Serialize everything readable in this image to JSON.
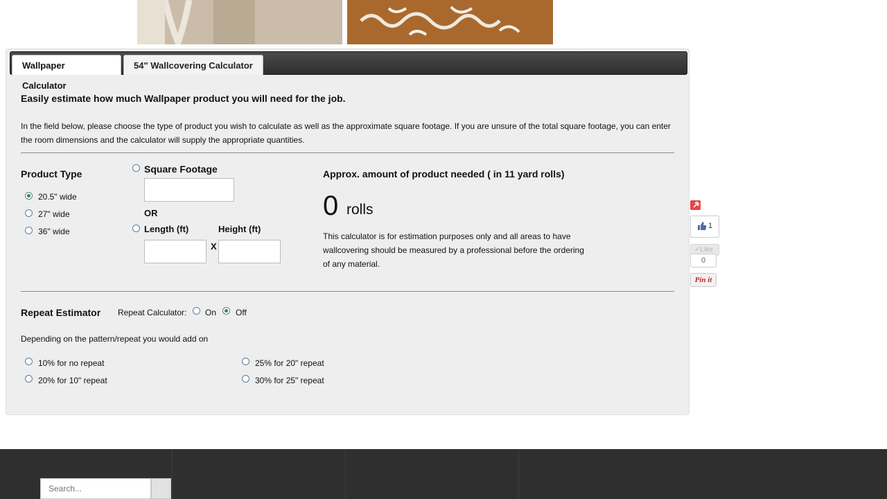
{
  "tabs": [
    {
      "label": "Wallpaper Calculator"
    },
    {
      "label": "54\" Wallcovering Calculator"
    }
  ],
  "intro": {
    "heading": "Easily estimate how much Wallpaper product you will need for the job.",
    "text": "In the field below, please choose the type of product you wish to calculate as well as the approximate square footage. If you are unsure of the total square footage, you can enter the room dimensions and the calculator will supply the appropriate quantities."
  },
  "product_type": {
    "heading": "Product Type",
    "options": [
      "20.5\" wide",
      "27\" wide",
      "36\" wide"
    ],
    "selected": "20.5\" wide"
  },
  "measure": {
    "square_footage_label": "Square Footage",
    "or_label": "OR",
    "length_label": "Length (ft)",
    "height_label": "Height (ft)",
    "times_symbol": "X",
    "square_footage_value": "",
    "length_value": "",
    "height_value": ""
  },
  "result": {
    "heading": "Approx. amount of product needed ( in 11 yard rolls)",
    "amount": "0",
    "unit": "rolls",
    "disclaimer": "This calculator is for estimation purposes only and all areas to have wallcovering should be measured by a professional before the ordering of any material."
  },
  "repeat": {
    "heading": "Repeat Estimator",
    "calc_label": "Repeat Calculator:",
    "on_label": "On",
    "off_label": "Off",
    "selected": "Off",
    "description": "Depending on the pattern/repeat you would add on",
    "options": [
      "10% for no repeat",
      "20% for 10\" repeat",
      "25% for 20\" repeat",
      "30% for 25\" repeat"
    ]
  },
  "social": {
    "like_count": "1",
    "like_label": "Like",
    "share_count": "0",
    "pin_label": "Pin it"
  },
  "footer": {
    "search_placeholder": "Search..."
  },
  "colors": {
    "tabbar": "#333333",
    "panel": "#eeeeee",
    "radio_checked": "#2e8b3a",
    "footer": "#2f2f2f"
  }
}
